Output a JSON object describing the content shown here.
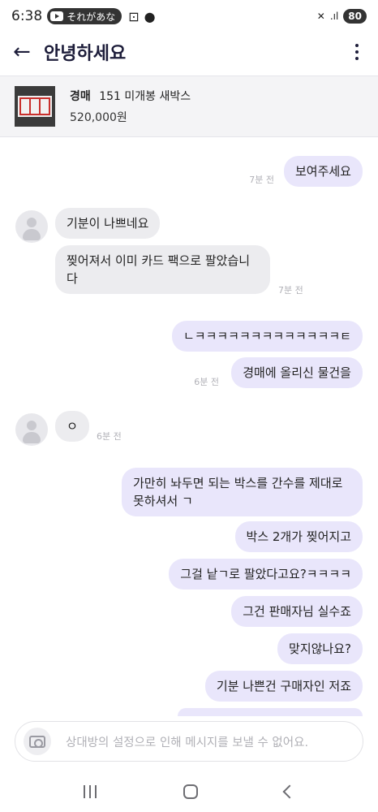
{
  "status_bar": {
    "time": "6:38",
    "notification": "それがあな",
    "battery": "80"
  },
  "header": {
    "title": "안녕하세요"
  },
  "product": {
    "type": "경매",
    "name": "151 미개봉 새박스",
    "price": "520,000원"
  },
  "messages": [
    {
      "side": "out",
      "text": "보여주세요",
      "time": "7분 전"
    },
    {
      "side": "in",
      "text": "기분이 나쁘네요",
      "time": ""
    },
    {
      "side": "in",
      "text": "찢어져서 이미 카드 팩으로 팔았습니\n다",
      "time": "7분 전"
    },
    {
      "side": "out",
      "text": "ㄴㅋㅋㅋㅋㅋㅋㅋㅋㅋㅋㅋㅋㅋㅌ",
      "time": ""
    },
    {
      "side": "out",
      "text": "경매에 올리신 물건을",
      "time": "6분 전"
    },
    {
      "side": "in",
      "text": "ㅇ",
      "time": "6분 전"
    },
    {
      "side": "out",
      "text": "가만히 놔두면 되는 박스를 간수를 제대로\n못하셔서 ㄱ",
      "time": ""
    },
    {
      "side": "out",
      "text": "박스 2개가 찢어지고",
      "time": ""
    },
    {
      "side": "out",
      "text": "그걸 낱ㄱ로 팔았다고요?ㅋㅋㅋㅋ",
      "time": ""
    },
    {
      "side": "out",
      "text": "그건 판매자님 실수죠",
      "time": ""
    },
    {
      "side": "out",
      "text": "맞지않나요?",
      "time": ""
    },
    {
      "side": "out",
      "text": "기분 나쁜건 구매자인 저죠",
      "time": ""
    }
  ],
  "input": {
    "placeholder": "상대방의 설정으로 인해 메시지를 보낼 수 없어요."
  },
  "icons": [
    "back-arrow-icon",
    "more-vertical-icon",
    "camera-icon",
    "avatar-icon",
    "youtube-icon",
    "mute-icon",
    "signal-icon",
    "battery-icon"
  ],
  "colors": {
    "outgoing_bubble": "#e9e6fb",
    "incoming_bubble": "#ececef",
    "header_text": "#1d1d3a"
  }
}
